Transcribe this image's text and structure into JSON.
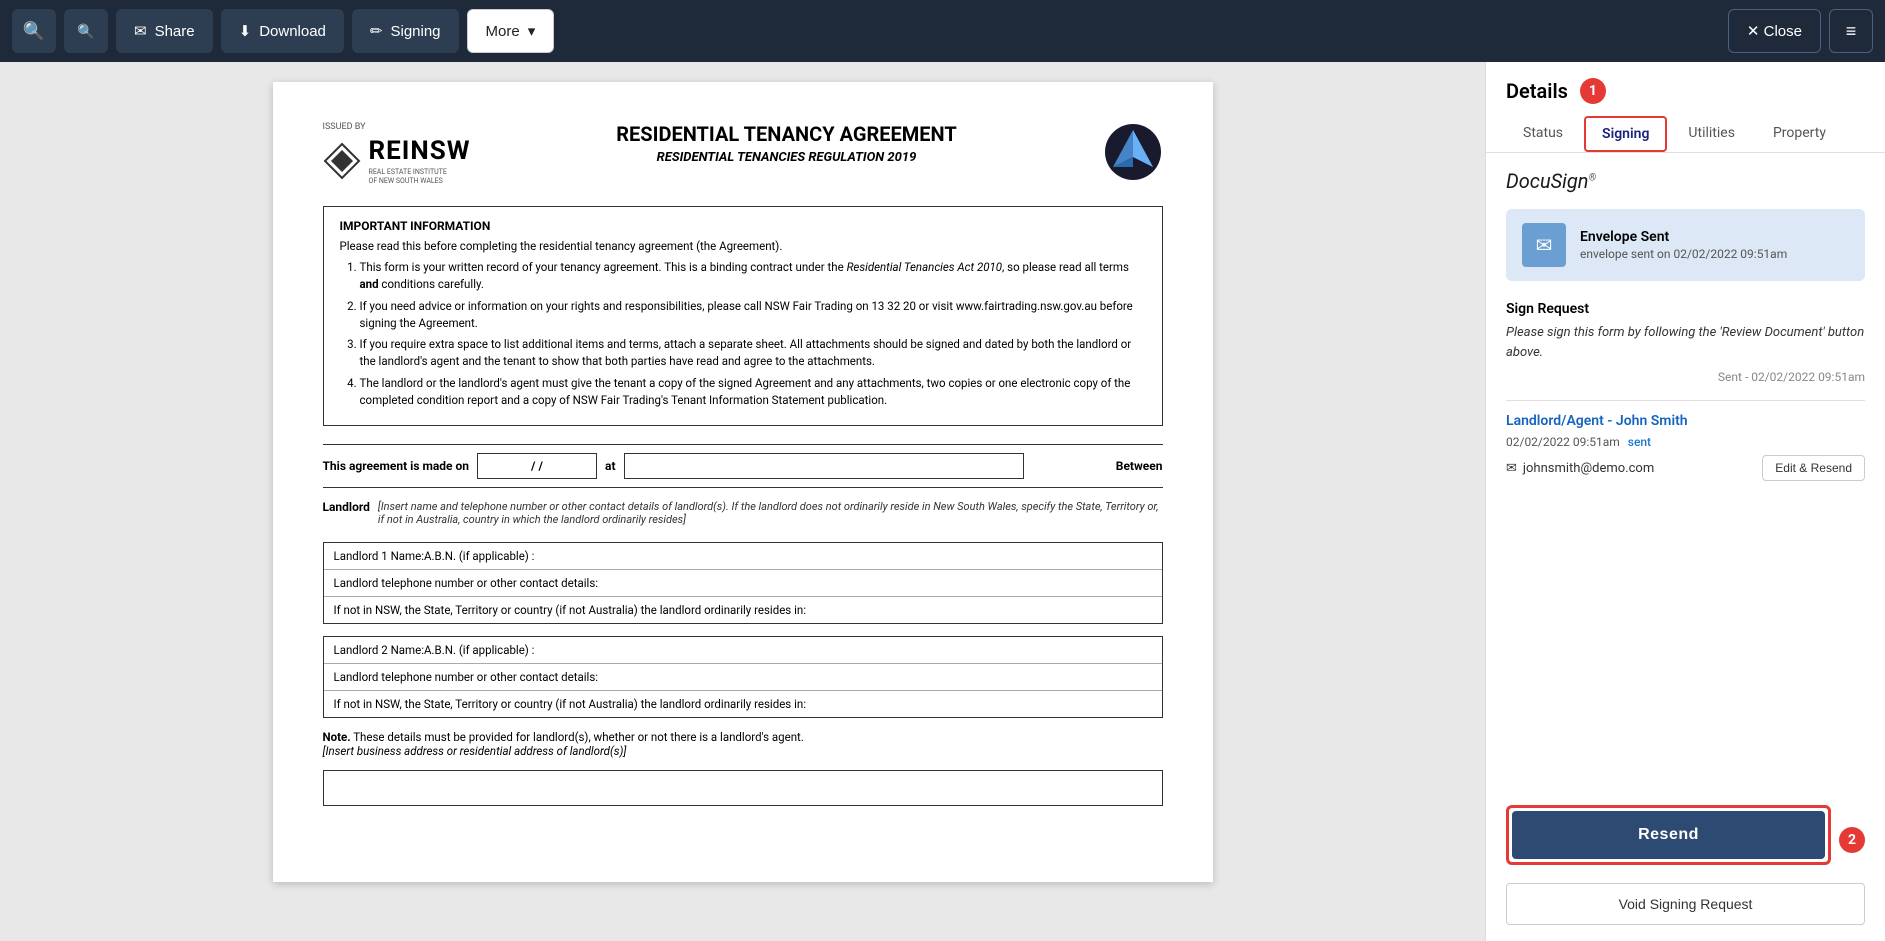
{
  "toolbar": {
    "zoom_in_label": "🔍",
    "zoom_out_label": "🔍",
    "share_label": "Share",
    "download_label": "Download",
    "signing_label": "Signing",
    "more_label": "More",
    "close_label": "✕ Close",
    "menu_icon": "≡"
  },
  "document": {
    "issued_by": "ISSUED BY",
    "logo_text": "REINSW",
    "logo_sub": "REAL ESTATE INSTITUTE\nOF NEW SOUTH WALES",
    "title": "RESIDENTIAL TENANCY AGREEMENT",
    "subtitle": "RESIDENTIAL TENANCIES REGULATION 2019",
    "important_heading": "IMPORTANT INFORMATION",
    "important_intro": "Please read this before completing the residential tenancy agreement (the Agreement).",
    "important_items": [
      "This form is your written record of your tenancy agreement. This is a binding contract under the Residential Tenancies Act 2010, so please read all terms and conditions carefully.",
      "If you need advice or information on your rights and responsibilities, please call NSW Fair Trading on 13 32 20 or visit www.fairtrading.nsw.gov.au before signing the Agreement.",
      "If you require extra space to list additional items and terms, attach a separate sheet. All attachments should be signed and dated by both the landlord or the landlord's agent and the tenant to show that both parties have read and agree to the attachments.",
      "The landlord or the landlord's agent must give the tenant a copy of the signed Agreement and any attachments, two copies or one electronic copy of the completed condition report and a copy of NSW Fair Trading's Tenant Information Statement publication."
    ],
    "agreement_made_on": "This agreement is made on",
    "at": "at",
    "between": "Between",
    "landlord_label": "Landlord",
    "landlord_italic": "[Insert name and telephone number or other contact details of landlord(s). If the landlord does not ordinarily reside in New South Wales, specify the State, Territory or, if not in Australia, country in which the landlord ordinarily resides]",
    "landlord1_name": "Landlord 1   Name:",
    "landlord1_abn": "A.B.N.  (if applicable) :",
    "landlord1_tel": "Landlord telephone number or other contact details:",
    "landlord1_state": "If not in NSW, the State, Territory or country (if not Australia) the landlord ordinarily resides in:",
    "landlord2_name": "Landlord 2   Name:",
    "landlord2_abn": "A.B.N.  (if applicable) :",
    "landlord2_tel": "Landlord telephone number or other contact details:",
    "landlord2_state": "If not in NSW, the State, Territory or country (if not Australia) the landlord ordinarily resides in:",
    "note_bold": "Note.",
    "note_text": " These details must be provided for landlord(s), whether or not there is a landlord's agent.",
    "note_italic": "[Insert business address or residential address of landlord(s)]"
  },
  "panel": {
    "title": "Details",
    "badge1": "1",
    "badge2": "2",
    "tabs": [
      {
        "label": "Status",
        "active": false
      },
      {
        "label": "Signing",
        "active": true
      },
      {
        "label": "Utilities",
        "active": false
      },
      {
        "label": "Property",
        "active": false
      }
    ],
    "docusign_label": "DocuSign",
    "envelope_title": "Envelope Sent",
    "envelope_sub": "envelope sent on 02/02/2022 09:51am",
    "sign_request_title": "Sign Request",
    "sign_request_text": "Please sign this form by following the 'Review Document' button above.",
    "sign_request_sent": "Sent - 02/02/2022 09:51am",
    "signer_name": "Landlord/Agent - John Smith",
    "signer_datetime": "02/02/2022 09:51am",
    "signer_status": "sent",
    "signer_email": "johnsmith@demo.com",
    "edit_resend_label": "Edit & Resend",
    "resend_label": "Resend",
    "void_label": "Void Signing Request"
  }
}
